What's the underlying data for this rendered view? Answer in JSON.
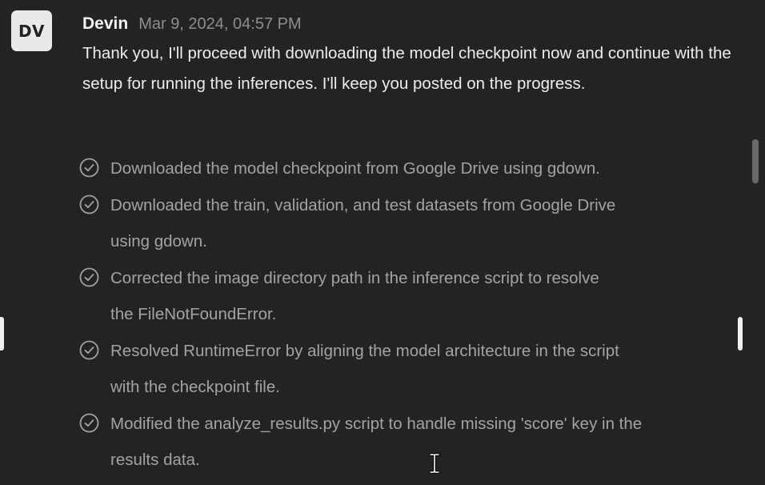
{
  "message": {
    "avatar_initials": "DV",
    "author": "Devin",
    "timestamp": "Mar 9, 2024, 04:57 PM",
    "text": "Thank you, I'll proceed with downloading the model checkpoint now and continue with the setup for running the inferences. I'll keep you posted on the progress."
  },
  "tasks": [
    {
      "icon": "check-circle-icon",
      "text": "Downloaded the model checkpoint from Google Drive using gdown."
    },
    {
      "icon": "check-circle-icon",
      "text": "Downloaded the train, validation, and test datasets from Google Drive using gdown."
    },
    {
      "icon": "check-circle-icon",
      "text": "Corrected the image directory path in the inference script to resolve the FileNotFoundError."
    },
    {
      "icon": "check-circle-icon",
      "text": "Resolved RuntimeError by aligning the model architecture in the script with the checkpoint file."
    },
    {
      "icon": "check-circle-icon",
      "text": "Modified the analyze_results.py script to handle missing 'score' key in the results data."
    }
  ],
  "colors": {
    "background": "#232323",
    "author": "#f3f3f3",
    "timestamp": "#8e8e8e",
    "message_text": "#ededed",
    "task_text": "#a3a3a3",
    "avatar_bg": "#e9e9e9"
  }
}
